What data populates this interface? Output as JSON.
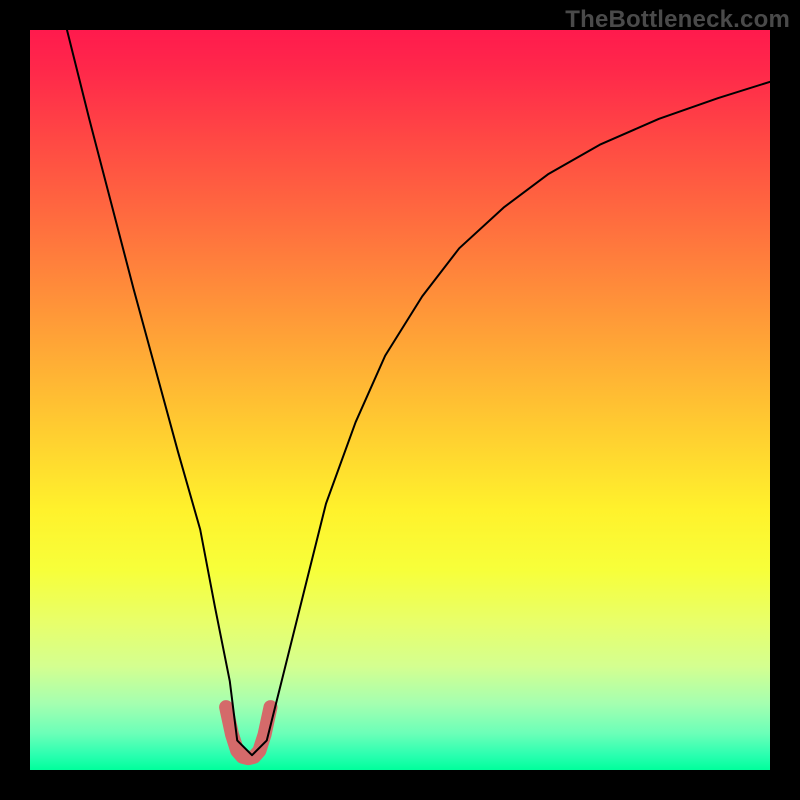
{
  "watermark": {
    "text": "TheBottleneck.com"
  },
  "chart_data": {
    "type": "line",
    "title": "",
    "xlabel": "",
    "ylabel": "",
    "xlim": [
      0,
      100
    ],
    "ylim": [
      0,
      100
    ],
    "grid": false,
    "legend": false,
    "series": [
      {
        "name": "bottleneck-curve",
        "x": [
          5,
          8,
          11,
          14,
          17,
          20,
          23,
          25,
          27,
          28,
          30,
          32,
          34,
          37,
          40,
          44,
          48,
          53,
          58,
          64,
          70,
          77,
          85,
          93,
          100
        ],
        "values": [
          100,
          88,
          76.5,
          65,
          54,
          43,
          32.5,
          22,
          12,
          4,
          2,
          4,
          12,
          24,
          36,
          47,
          56,
          64,
          70.5,
          76,
          80.5,
          84.5,
          88,
          90.8,
          93
        ]
      }
    ],
    "highlight": {
      "name": "optimal-dip",
      "x": [
        26.5,
        27.3,
        28.0,
        28.7,
        29.5,
        30.3,
        31.0,
        31.7,
        32.5
      ],
      "values": [
        8.5,
        4.8,
        2.6,
        1.8,
        1.6,
        1.8,
        2.6,
        4.8,
        8.5
      ]
    },
    "background_gradient": {
      "top_color": "#ff1a4d",
      "mid_color": "#fff22c",
      "bottom_color": "#00ff9c"
    }
  }
}
